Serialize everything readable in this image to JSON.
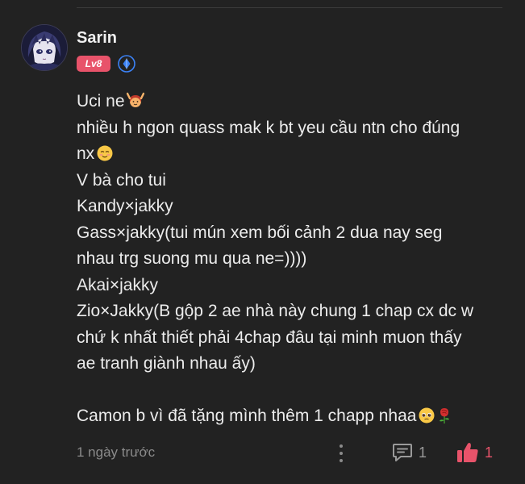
{
  "comment": {
    "author": {
      "name": "Sarin",
      "level_badge": "Lv8",
      "avatar_icon": "anime-avatar",
      "member_icon": "diamond-badge-icon"
    },
    "lines": [
      "Uci ne",
      "nhiều h ngon quass mak k bt yeu cầu ntn cho đúng",
      "nx",
      "V bà cho tui",
      "Kandy×jakky",
      "Gass×jakky(tui mún xem bối cảnh 2 dua nay seg",
      "nhau trg suong mu qua ne=))))",
      "Akai×jakky",
      "Zio×Jakky(B gộp 2 ae nhà này chung 1 chap cx dc w",
      "chứ k nhất thiết phải 4chap đâu tại minh muon thấy",
      "ae tranh giành nhau ấy)",
      "Camon b vì đã tặng mình thêm 1 chapp nhaa"
    ],
    "footer": {
      "time": "1 ngày trước",
      "reply_count": "1",
      "like_count": "1"
    }
  },
  "colors": {
    "background": "#222222",
    "text": "#ececec",
    "accent": "#e8536a",
    "muted": "#8b8b8b",
    "member_badge": "#3b82f6"
  }
}
